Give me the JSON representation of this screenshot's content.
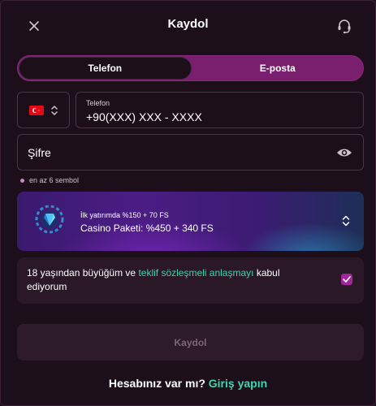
{
  "header": {
    "title": "Kaydol",
    "close_icon": "close-icon",
    "support_icon": "headset-support-icon"
  },
  "tabs": [
    {
      "label": "Telefon",
      "active": true
    },
    {
      "label": "E-posta",
      "active": false
    }
  ],
  "phone": {
    "country_flag": "turkey-flag-icon",
    "label": "Telefon",
    "value": "+90(XXX) XXX - XXXX"
  },
  "password": {
    "placeholder": "Şifre",
    "hint": "en az 6 sembol",
    "eye_icon": "eye-icon"
  },
  "bonus": {
    "subtitle": "İlk yatırımda %150 + 70 FS",
    "title": "Casino Paketi: %450 + 340 FS"
  },
  "agreement": {
    "text_before": "18 yaşından büyüğüm ve ",
    "link_text": "teklif sözleşmeli anlaşmayı",
    "text_after": " kabul ediyorum",
    "checked": true
  },
  "submit_label": "Kaydol",
  "login": {
    "question": "Hesabınız var mı?",
    "link": "Giriş yapın"
  },
  "colors": {
    "background": "#1c0f19",
    "accent": "#7a1e6e",
    "link": "#3dd5b0",
    "checkbox": "#a3259a"
  }
}
